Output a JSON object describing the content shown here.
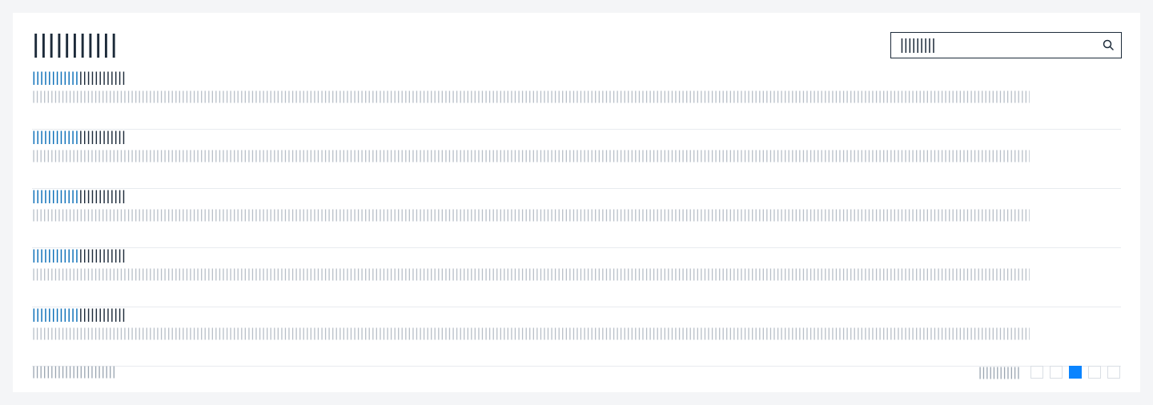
{
  "header": {
    "title": "||||||||||||||||||||||||"
  },
  "search": {
    "value": "||||||||||",
    "icon": "search-icon"
  },
  "rows": [
    {
      "link": "||||||||||||",
      "rest": "||||||||||||",
      "desc": "|||||||||||||||||||||||||||||||||||||||||||||||||||||||||||||||||||||||||||||||||||||||||||||||||||||||||||||||||||||||||||||||||||||||||||||||||||||||||||||||||||||||||||||||||||||||||||||||||||||||||||||||||||||||||||||||||||||||||||||||||||||||||||||||||||||||||||||||||||||||||||||||||||"
    },
    {
      "link": "||||||||||||",
      "rest": "||||||||||||",
      "desc": "|||||||||||||||||||||||||||||||||||||||||||||||||||||||||||||||||||||||||||||||||||||||||||||||||||||||||||||||||||||||||||||||||||||||||||||||||||||||||||||||||||||||||||||||||||||||||||||||||||||||||||||||||||||||||||||||||||||||||||||||||||||||||||||||||||||||||||||||||||||||||||||||||||"
    },
    {
      "link": "||||||||||||",
      "rest": "||||||||||||",
      "desc": "|||||||||||||||||||||||||||||||||||||||||||||||||||||||||||||||||||||||||||||||||||||||||||||||||||||||||||||||||||||||||||||||||||||||||||||||||||||||||||||||||||||||||||||||||||||||||||||||||||||||||||||||||||||||||||||||||||||||||||||||||||||||||||||||||||||||||||||||||||||||||||||||||||"
    },
    {
      "link": "||||||||||||",
      "rest": "||||||||||||",
      "desc": "|||||||||||||||||||||||||||||||||||||||||||||||||||||||||||||||||||||||||||||||||||||||||||||||||||||||||||||||||||||||||||||||||||||||||||||||||||||||||||||||||||||||||||||||||||||||||||||||||||||||||||||||||||||||||||||||||||||||||||||||||||||||||||||||||||||||||||||||||||||||||||||||||||"
    },
    {
      "link": "||||||||||||",
      "rest": "||||||||||||",
      "desc": "|||||||||||||||||||||||||||||||||||||||||||||||||||||||||||||||||||||||||||||||||||||||||||||||||||||||||||||||||||||||||||||||||||||||||||||||||||||||||||||||||||||||||||||||||||||||||||||||||||||||||||||||||||||||||||||||||||||||||||||||||||||||||||||||||||||||||||||||||||||||||||||||||||"
    }
  ],
  "footer": {
    "left_text": "||||||||||||||||||||||||",
    "right_text": "||||||||||||"
  },
  "pagination": {
    "pages": 5,
    "active_index": 2,
    "active_color": "#0a84ff",
    "border_color": "#d9dee4"
  },
  "colors": {
    "link": "#0b6fb8",
    "title": "#1d2b3a",
    "muted": "#b8bfc8",
    "background": "#f4f5f7"
  }
}
